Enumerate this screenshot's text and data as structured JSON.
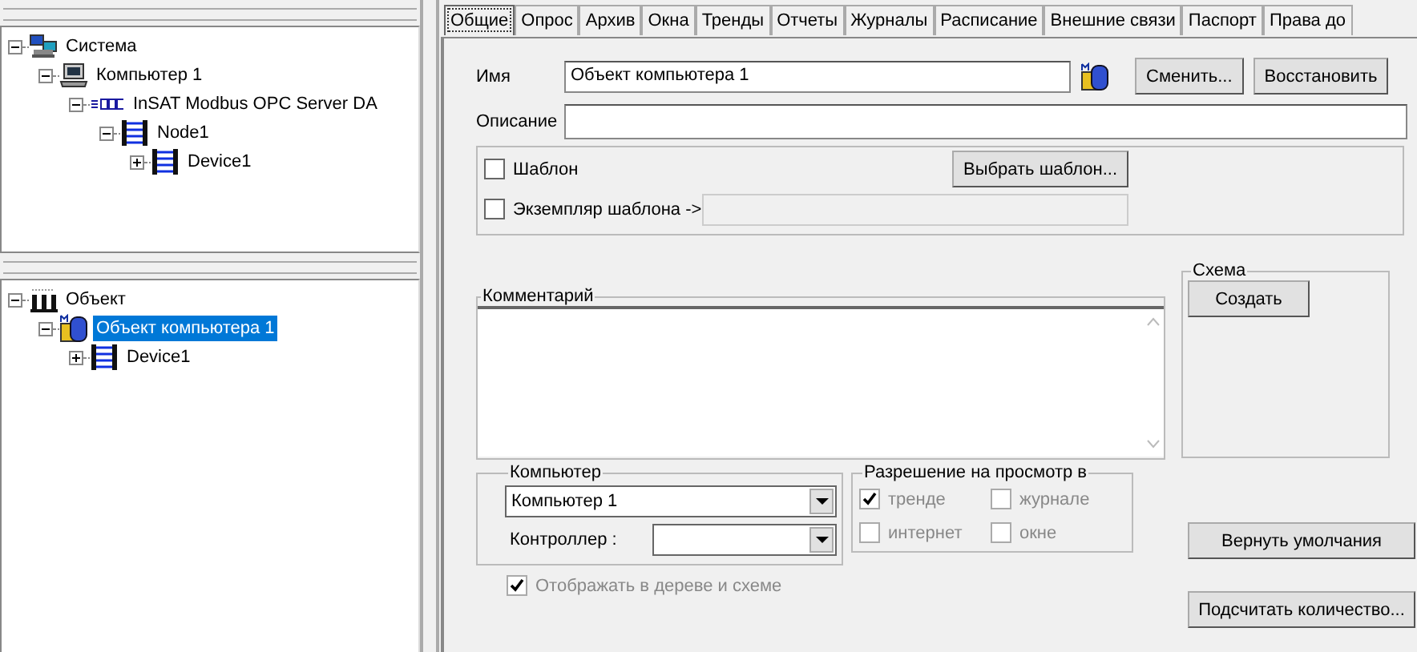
{
  "system_tree": {
    "items": [
      {
        "label": "Система",
        "kind": "network",
        "expanded": true,
        "selected": false,
        "children": [
          {
            "label": "Компьютер 1",
            "kind": "computer",
            "expanded": true,
            "selected": false,
            "children": [
              {
                "label": "InSAT Modbus OPC Server DA",
                "kind": "server",
                "expanded": true,
                "selected": false,
                "children": [
                  {
                    "label": "Node1",
                    "kind": "device",
                    "expanded": true,
                    "selected": false,
                    "children": [
                      {
                        "label": "Device1",
                        "kind": "device",
                        "expanded": false,
                        "selected": false
                      }
                    ]
                  }
                ]
              }
            ]
          }
        ]
      }
    ]
  },
  "object_tree": {
    "items": [
      {
        "label": "Объект",
        "kind": "object",
        "expanded": true,
        "selected": false,
        "children": [
          {
            "label": "Объект компьютера 1",
            "kind": "instance",
            "expanded": true,
            "selected": true,
            "children": [
              {
                "label": "Device1",
                "kind": "device",
                "expanded": false,
                "selected": false
              }
            ]
          }
        ]
      }
    ]
  },
  "tabs": [
    {
      "label": "Общие",
      "selected": true
    },
    {
      "label": "Опрос",
      "selected": false
    },
    {
      "label": "Архив",
      "selected": false
    },
    {
      "label": "Окна",
      "selected": false
    },
    {
      "label": "Тренды",
      "selected": false
    },
    {
      "label": "Отчеты",
      "selected": false
    },
    {
      "label": "Журналы",
      "selected": false
    },
    {
      "label": "Расписание",
      "selected": false
    },
    {
      "label": "Внешние связи",
      "selected": false
    },
    {
      "label": "Паспорт",
      "selected": false
    },
    {
      "label": "Права до",
      "selected": false
    }
  ],
  "name": {
    "label": "Имя",
    "value": "Объект компьютера 1",
    "buttons": [
      "Сменить...",
      "Восстановить"
    ]
  },
  "description": {
    "label": "Описание"
  },
  "template": {
    "checkbox": {
      "label": "Шаблон",
      "checked": false
    },
    "button": "Выбрать шаблон...",
    "instance": {
      "label": "Экземпляр шаблона ->",
      "checked": false
    }
  },
  "comment": {
    "title": "Комментарий"
  },
  "schema": {
    "title": "Схема",
    "button": "Создать"
  },
  "computer": {
    "title": "Компьютер",
    "value": "Компьютер 1",
    "controller_label": "Контроллер :"
  },
  "view_permission": {
    "title": "Разрешение на просмотр в",
    "options": [
      {
        "label": "тренде",
        "checked": true,
        "disabled": true
      },
      {
        "label": "журнале",
        "checked": false,
        "disabled": true
      },
      {
        "label": "интернет",
        "checked": false,
        "disabled": true
      },
      {
        "label": "окне",
        "checked": false,
        "disabled": true
      }
    ]
  },
  "show_in_tree": {
    "label": "Отображать в дереве и схеме",
    "checked": true,
    "disabled": true
  },
  "buttons": [
    "Вернуть умолчания",
    "Подсчитать количество..."
  ]
}
